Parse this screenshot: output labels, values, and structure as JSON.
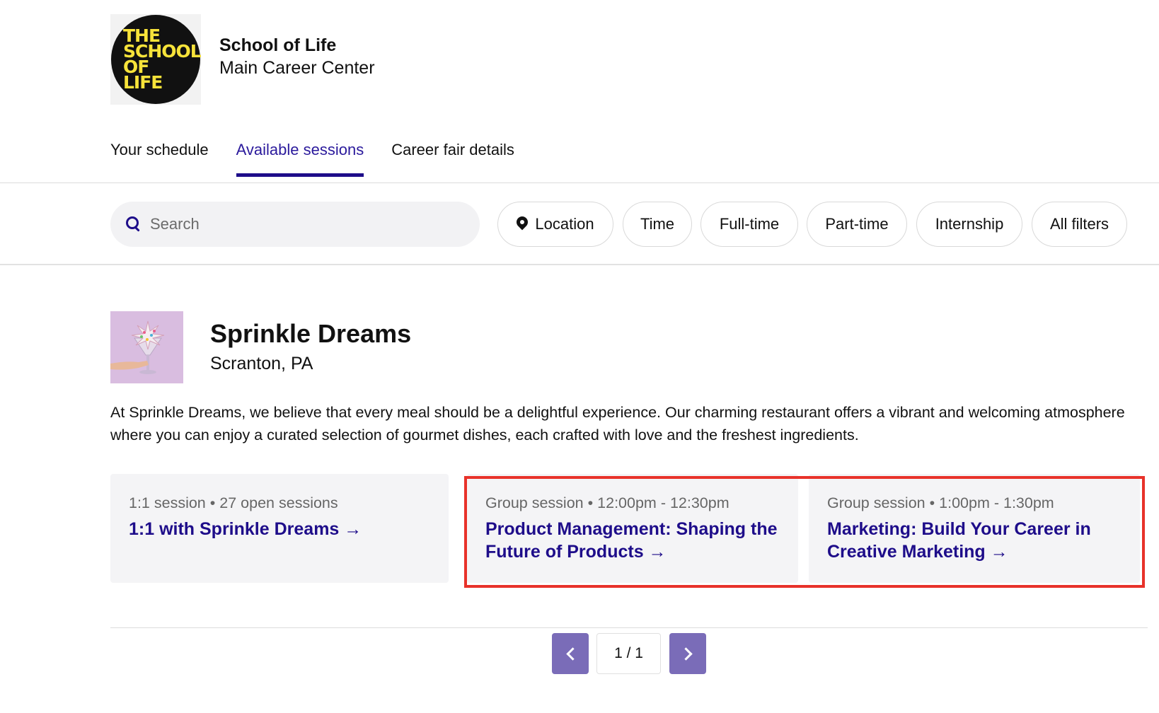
{
  "header": {
    "logo_lines": [
      "THE",
      "SCHOOL",
      "OF LIFE"
    ],
    "org_name": "School of Life",
    "org_subtitle": "Main Career Center"
  },
  "tabs": [
    {
      "label": "Your schedule",
      "active": false
    },
    {
      "label": "Available sessions",
      "active": true
    },
    {
      "label": "Career fair details",
      "active": false
    }
  ],
  "search": {
    "placeholder": "Search",
    "value": ""
  },
  "filters": [
    "Location",
    "Time",
    "Full-time",
    "Part-time",
    "Internship",
    "All filters"
  ],
  "employer": {
    "name": "Sprinkle Dreams",
    "location": "Scranton, PA",
    "description": "At Sprinkle Dreams, we believe that every meal should be a delightful experience. Our charming restaurant offers a vibrant and welcoming atmosphere where you can enjoy a curated selection of gourmet dishes, each crafted with love and the freshest ingredients."
  },
  "sessions": [
    {
      "type": "1:1 session",
      "detail": "27 open sessions",
      "title": "1:1 with Sprinkle Dreams →"
    },
    {
      "type": "Group session",
      "detail": "12:00pm - 12:30pm",
      "title": "Product Management: Shaping the Future of Products →"
    },
    {
      "type": "Group session",
      "detail": "1:00pm - 1:30pm",
      "title": "Marketing: Build Your Career in Creative Marketing →"
    }
  ],
  "separator": "•",
  "pagination": {
    "label": "1 / 1"
  },
  "colors": {
    "accent": "#1e0d8a",
    "pager": "#7a6cb8",
    "highlight": "#e8322a",
    "logo_yellow": "#f7e33a"
  }
}
